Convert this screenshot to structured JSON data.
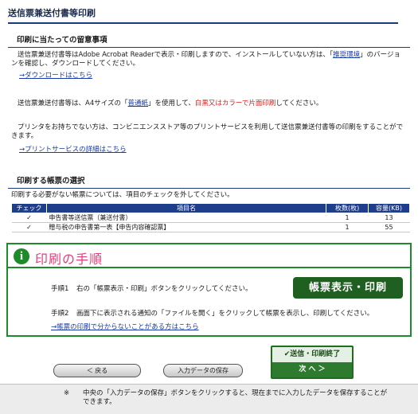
{
  "page_title": "送信票兼送付書等印刷",
  "notes_section": {
    "heading": "印刷に当たっての留意事項",
    "p1_before": "送信票兼送付書等はAdobe Acrobat Readerで表示・印刷しますので、インストールしていない方は、「",
    "p1_link": "推奨環境",
    "p1_after_line1": "」のバージョ",
    "p1_line2": "ンを確認し、ダウンロードしてください。",
    "download_link": "→ダウンロードはこちら",
    "p2_before": "送信票兼送付書等は、A4サイズの「",
    "p2_link": "普通紙",
    "p2_mid": "」を使用して、",
    "p2_red": "白黒又はカラーで片面印刷",
    "p2_after": "してください。",
    "p3_line1": "プリンタをお持ちでない方は、コンビニエンスストア等のプリントサービスを利用して送信票兼送付書等の印刷をすることがで",
    "p3_line2": "きます。",
    "print_service_link": "→プリントサービスの詳細はこちら"
  },
  "forms_section": {
    "heading": "印刷する帳票の選択",
    "instruction": "印刷する必要がない帳票については、項目のチェックを外してください。",
    "columns": [
      "チェック",
      "項目名",
      "枚数(枚)",
      "容量(KB)"
    ],
    "rows": [
      {
        "checked": "✓",
        "name": "申告書等送信票（兼送付書）",
        "pages": "1",
        "size": "13"
      },
      {
        "checked": "✓",
        "name": "贈与税の申告書第一表【申告内容確認票】",
        "pages": "1",
        "size": "55"
      }
    ]
  },
  "procedure": {
    "title": "印刷の手順",
    "step1_num": "手順1",
    "step1_text": "右の「帳票表示・印刷」ボタンをクリックしてください。",
    "step2_num": "手順2",
    "step2_text": "画面下に表示される通知の「ファイルを開く」をクリックして帳票を表示し、印刷してください。",
    "help_link": "→帳票の印刷で分からないことがある方はこちら",
    "print_button": "帳票表示・印刷"
  },
  "nav": {
    "back_button": "＜ 戻る",
    "save_button": "入力データの保存",
    "done_top": "✔送信・印刷終了",
    "done_bottom": "次 へ ＞"
  },
  "footer_note": {
    "mark": "※",
    "line1": "中央の「入力データの保存」ボタンをクリックすると、現在までに入力したデータを保存することが",
    "line2": "できます。"
  },
  "colors": {
    "header_blue": "#1e3e8c",
    "procedure_green": "#1e8a2a",
    "print_button_green": "#1f5f1f",
    "title_pink": "#e0407a",
    "warning_red": "#e01a1a",
    "link_blue": "#1a3aa8"
  }
}
